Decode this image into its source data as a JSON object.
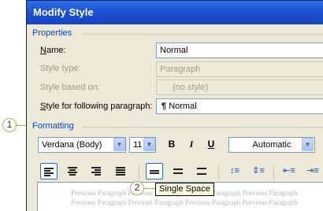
{
  "window": {
    "title": "Modify Style"
  },
  "properties": {
    "group_label": "Properties",
    "name_label_pre": "",
    "name_label_ak": "N",
    "name_label_post": "ame:",
    "name_value": "Normal",
    "style_type_label": "Style type:",
    "style_type_value": "Paragraph",
    "based_on_label": "Style based on:",
    "based_on_value": "(no style)",
    "following_label_ak": "S",
    "following_label_post": "tyle for following paragraph:",
    "following_value": "Normal",
    "following_icon": "pilcrow-icon"
  },
  "formatting": {
    "group_label": "Formatting",
    "font_value": "Verdana (Body)",
    "size_value": "11",
    "bold_label": "B",
    "italic_label": "I",
    "underline_label": "U",
    "color_value": "Automatic"
  },
  "preview": {
    "line1": "Previous Paragraph Previous Paragraph Previous Paragraph Previous Paragraph",
    "line2": "Previous Paragraph Previous Paragraph Previous Paragraph Previous Paragraph"
  },
  "callouts": {
    "one": "1",
    "two": "2"
  },
  "tooltip": {
    "text": "Single Space"
  },
  "colors": {
    "callout": "#8fc24a",
    "group_label": "#0046d5",
    "titlebar": "#1a4fcf"
  }
}
